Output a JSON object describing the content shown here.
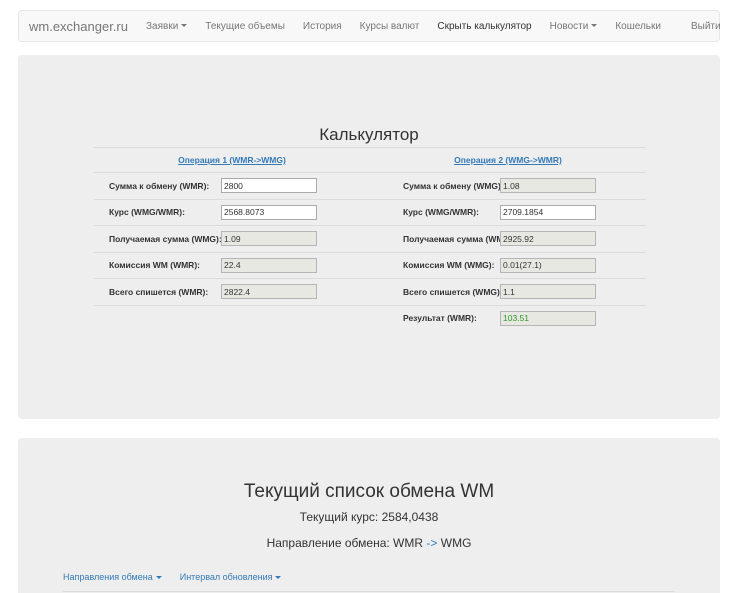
{
  "navbar": {
    "brand": "wm.exchanger.ru",
    "items": [
      {
        "label": "Заявки",
        "dropdown": true
      },
      {
        "label": "Текущие объемы",
        "dropdown": false
      },
      {
        "label": "История",
        "dropdown": false
      },
      {
        "label": "Курсы валют",
        "dropdown": false
      },
      {
        "label": "Скрыть калькулятор",
        "dropdown": false
      },
      {
        "label": "Новости",
        "dropdown": true
      }
    ],
    "right": [
      {
        "label": "Кошельки"
      },
      {
        "label": "Выйти"
      }
    ]
  },
  "calculator": {
    "title": "Калькулятор",
    "op1": {
      "header": "Операция 1 (WMR->WMG)",
      "rows": [
        {
          "label": "Сумма к обмену (WMR):",
          "value": "2800",
          "editable": true
        },
        {
          "label": "Курс (WMG/WMR):",
          "value": "2568.8073",
          "editable": true
        },
        {
          "label": "Получаемая сумма (WMG):",
          "value": "1.09",
          "editable": false
        },
        {
          "label": "Комиссия WM (WMR):",
          "value": "22.4",
          "editable": false
        },
        {
          "label": "Всего спишется (WMR):",
          "value": "2822.4",
          "editable": false
        }
      ]
    },
    "op2": {
      "header": "Операция 2 (WMG->WMR)",
      "rows": [
        {
          "label": "Сумма к обмену (WMG):",
          "value": "1.08",
          "editable": false
        },
        {
          "label": "Курс (WMG/WMR):",
          "value": "2709.1854",
          "editable": true
        },
        {
          "label": "Получаемая сумма (WMR):",
          "value": "2925.92",
          "editable": false
        },
        {
          "label": "Комиссия WM (WMG):",
          "value": "0.01(27.1)",
          "editable": false
        },
        {
          "label": "Всего спишется (WMG):",
          "value": "1.1",
          "editable": false
        },
        {
          "label": "Результат (WMR):",
          "value": "103.51",
          "editable": false
        }
      ]
    },
    "colors": {
      "result": "#2a9a2a",
      "link": "#337ab7"
    }
  },
  "exchange_list": {
    "title": "Текущий список обмена WM",
    "rate_line": "Текущий курс: 2584,0438",
    "direction_prefix": "Направление обмена: WMR",
    "direction_arrow": "->",
    "direction_suffix": "WMG",
    "dropdowns": [
      {
        "label": "Направления обмена"
      },
      {
        "label": "Интервал обновления"
      }
    ]
  }
}
